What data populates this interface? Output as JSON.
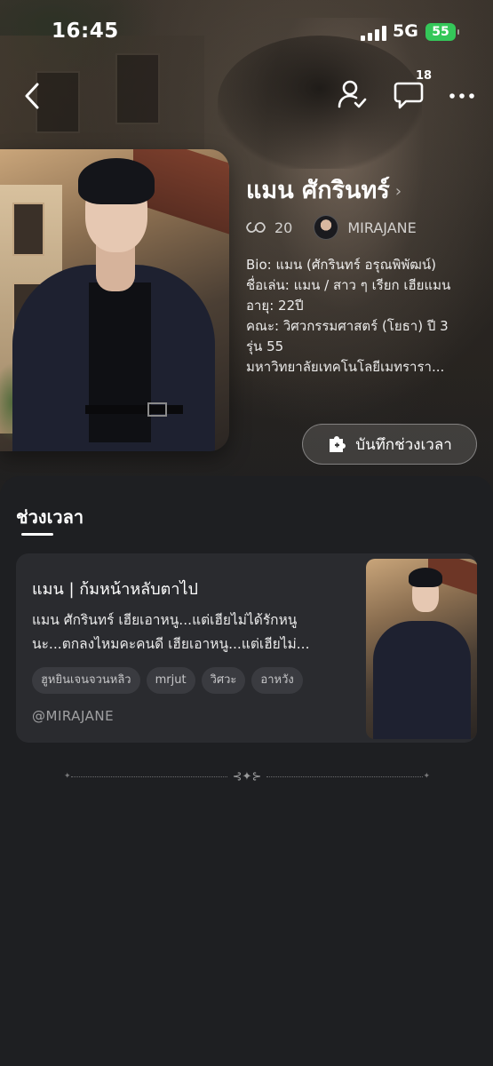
{
  "status_bar": {
    "time": "16:45",
    "network": "5G",
    "battery": "55"
  },
  "nav": {
    "comment_count": "18"
  },
  "profile": {
    "name": "แมน ศักรินทร์",
    "stat_count": "20",
    "author": "MIRAJANE",
    "bio_lines": [
      "Bio: แมน (ศักรินทร์ อรุณพิพัฒน์)",
      "ชื่อเล่น: แมน / สาว ๆ เรียก เฮียแมน",
      "อายุ: 22ปี",
      "คณะ: วิศวกรรมศาสตร์ (โยธา) ปี 3",
      "รุ่น 55",
      "มหาวิทยาลัยเทคโนโลยีเมทรารา..."
    ],
    "save_button_label": "บันทึกช่วงเวลา"
  },
  "section": {
    "title": "ช่วงเวลา"
  },
  "moment_card": {
    "title": "แมน | ก้มหน้าหลับตาไป",
    "description_lines": [
      "แมน ศักรินทร์ เฮียเอาหนู...แต่เฮียไม่ได้รักหนู",
      "นะ...ตกลงไหมคะคนดี เฮียเอาหนู...แต่เฮียไม่..."
    ],
    "tags": [
      "ฮูหยินเจนจวนหลิว",
      "mrjut",
      "วิศวะ",
      "อาหวัง"
    ],
    "author": "@MIRAJANE"
  },
  "colors": {
    "background": "#1e1f22",
    "card": "#2a2b2f",
    "battery_green": "#34c759"
  },
  "icons": {
    "back": "chevron-left-icon",
    "user_check": "user-check-icon",
    "comments": "chat-bubble-icon",
    "more": "more-horizontal-icon",
    "stats": "infinity-icon",
    "save": "puzzle-icon"
  }
}
